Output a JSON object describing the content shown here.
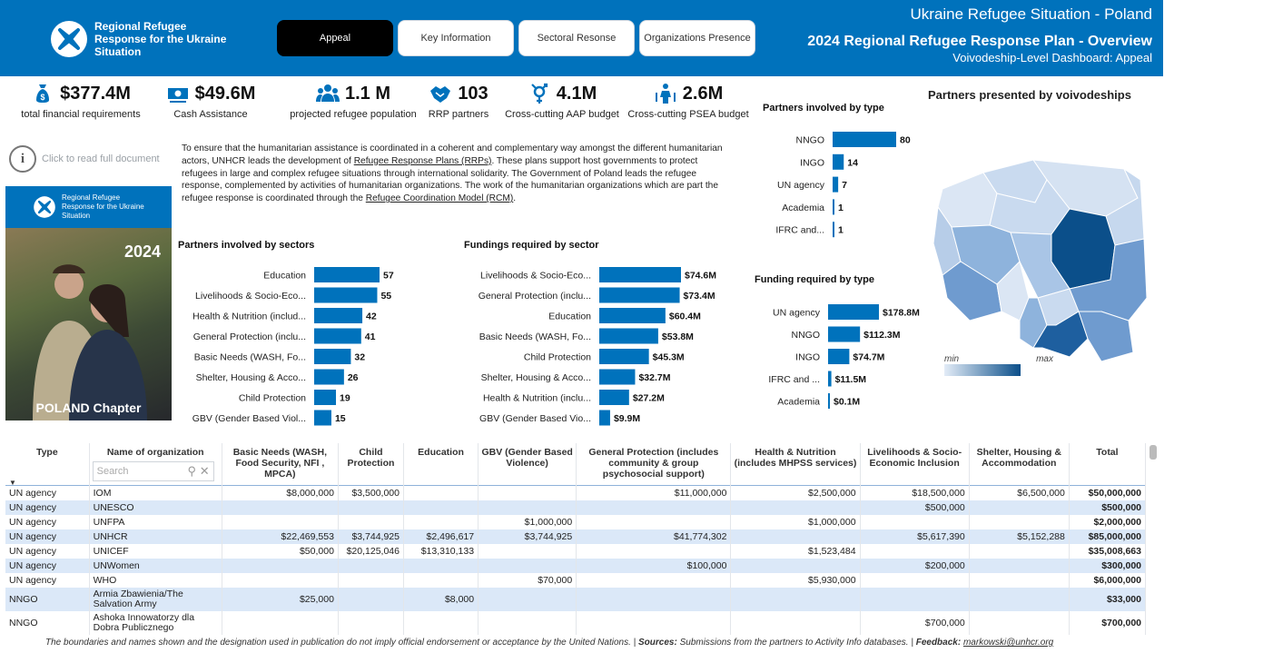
{
  "header": {
    "logo_text": "Regional Refugee Response for the Ukraine Situation",
    "title": "Ukraine Refugee Situation - Poland",
    "subtitle": "2024 Regional Refugee Response Plan - Overview",
    "subtitle2": "Voivodeship-Level Dashboard: Appeal",
    "nav": [
      "Appeal",
      "Key Information",
      "Sectoral Resonse",
      "Organizations Presence"
    ],
    "active_nav": "Appeal"
  },
  "kpis": [
    {
      "value": "$377.4M",
      "label": "total financial requirements",
      "icon": "money-bag-icon"
    },
    {
      "value": "$49.6M",
      "label": "Cash Assistance",
      "icon": "cash-icon"
    },
    {
      "value": "1.1 M",
      "label": "projected refugee population",
      "icon": "people-icon"
    },
    {
      "value": "103",
      "label": "RRP partners",
      "icon": "handshake-icon"
    },
    {
      "value": "4.1M",
      "label": "Cross-cutting AAP budget",
      "icon": "gender-icon"
    },
    {
      "value": "2.6M",
      "label": "Cross-cutting PSEA  budget",
      "icon": "protection-icon"
    }
  ],
  "info": {
    "label": "Click to read full document",
    "icon_glyph": "i"
  },
  "cover": {
    "logo_text": "Regional Refugee Response for the Ukraine Situation",
    "year": "2024",
    "chapter": "POLAND Chapter"
  },
  "intro": {
    "p1": "To ensure that the humanitarian assistance is coordinated in a coherent and complementary way amongst the different humanitarian actors, UNHCR leads the development of ",
    "link1": "Refugee Response Plans (RRPs)",
    "p2": ". These plans support host governments to protect refugees in large and complex refugee situations through international solidarity. The Government of Poland leads the refugee response, complemented by activities of humanitarian organizations. The work of the humanitarian organizations which are part the refugee response is coordinated through the ",
    "link2": "Refugee Coordination Model (RCM)",
    "p3": "."
  },
  "colors": {
    "brand": "#0072bc",
    "bar": "#0072bc",
    "row_alt": "#dbe8f8"
  },
  "chart_data": [
    {
      "type": "bar",
      "orientation": "horizontal",
      "title": "Partners involved by sectors",
      "categories": [
        "Education",
        "Livelihoods & Socio-Eco...",
        "Health & Nutrition (includ...",
        "General Protection (inclu...",
        "Basic Needs (WASH, Fo...",
        "Shelter, Housing & Acco...",
        "Child Protection",
        "GBV (Gender Based Viol..."
      ],
      "values": [
        57,
        55,
        42,
        41,
        32,
        26,
        19,
        15
      ],
      "labels": [
        "57",
        "55",
        "42",
        "41",
        "32",
        "26",
        "19",
        "15"
      ],
      "max": 57
    },
    {
      "type": "bar",
      "orientation": "horizontal",
      "title": "Fundings required by sector",
      "categories": [
        "Livelihoods & Socio-Eco...",
        "General Protection (inclu...",
        "Education",
        "Basic Needs (WASH, Fo...",
        "Child Protection",
        "Shelter, Housing & Acco...",
        "Health & Nutrition (inclu...",
        "GBV (Gender Based Vio..."
      ],
      "values": [
        74.6,
        73.4,
        60.4,
        53.8,
        45.3,
        32.7,
        27.2,
        9.9
      ],
      "labels": [
        "$74.6M",
        "$73.4M",
        "$60.4M",
        "$53.8M",
        "$45.3M",
        "$32.7M",
        "$27.2M",
        "$9.9M"
      ],
      "max": 74.6
    },
    {
      "type": "bar",
      "orientation": "horizontal",
      "title": "Partners involved by type",
      "categories": [
        "NNGO",
        "INGO",
        "UN agency",
        "Academia",
        "IFRC and..."
      ],
      "values": [
        80,
        14,
        7,
        1,
        1
      ],
      "labels": [
        "80",
        "14",
        "7",
        "1",
        "1"
      ],
      "max": 80
    },
    {
      "type": "bar",
      "orientation": "horizontal",
      "title": "Funding required by type",
      "categories": [
        "UN agency",
        "NNGO",
        "INGO",
        "IFRC and ...",
        "Academia"
      ],
      "values": [
        178.8,
        112.3,
        74.7,
        11.5,
        0.1
      ],
      "labels": [
        "$178.8M",
        "$112.3M",
        "$74.7M",
        "$11.5M",
        "$0.1M"
      ],
      "max": 178.8
    }
  ],
  "map": {
    "title": "Partners presented by voivodeships",
    "legend_min": "min",
    "legend_max": "max",
    "color_low": "#e3ecf7",
    "color_high": "#0b4f8a"
  },
  "table": {
    "search_placeholder": "Search",
    "headers": [
      "Type",
      "Name of organization",
      "Basic Needs (WASH, Food Security, NFI , MPCA)",
      "Child Protection",
      "Education",
      "GBV (Gender Based Violence)",
      "General Protection (includes community & group psychosocial support)",
      "Health & Nutrition (includes MHPSS services)",
      "Livelihoods & Socio-Economic Inclusion",
      "Shelter, Housing & Accommodation",
      "Total"
    ],
    "rows": [
      [
        "UN agency",
        "IOM",
        "$8,000,000",
        "$3,500,000",
        "",
        "",
        "$11,000,000",
        "$2,500,000",
        "$18,500,000",
        "$6,500,000",
        "$50,000,000"
      ],
      [
        "UN agency",
        "UNESCO",
        "",
        "",
        "",
        "",
        "",
        "",
        "$500,000",
        "",
        "$500,000"
      ],
      [
        "UN agency",
        "UNFPA",
        "",
        "",
        "",
        "$1,000,000",
        "",
        "$1,000,000",
        "",
        "",
        "$2,000,000"
      ],
      [
        "UN agency",
        "UNHCR",
        "$22,469,553",
        "$3,744,925",
        "$2,496,617",
        "$3,744,925",
        "$41,774,302",
        "",
        "$5,617,390",
        "$5,152,288",
        "$85,000,000"
      ],
      [
        "UN agency",
        "UNICEF",
        "$50,000",
        "$20,125,046",
        "$13,310,133",
        "",
        "",
        "$1,523,484",
        "",
        "",
        "$35,008,663"
      ],
      [
        "UN agency",
        "UNWomen",
        "",
        "",
        "",
        "",
        "$100,000",
        "",
        "$200,000",
        "",
        "$300,000"
      ],
      [
        "UN agency",
        "WHO",
        "",
        "",
        "",
        "$70,000",
        "",
        "$5,930,000",
        "",
        "",
        "$6,000,000"
      ],
      [
        "NNGO",
        "Armia Zbawienia/The Salvation Army",
        "$25,000",
        "",
        "$8,000",
        "",
        "",
        "",
        "",
        "",
        "$33,000"
      ],
      [
        "NNGO",
        "Ashoka Innowatorzy dla Dobra Publicznego",
        "",
        "",
        "",
        "",
        "",
        "",
        "$700,000",
        "",
        "$700,000"
      ]
    ]
  },
  "footer": {
    "text": "The boundaries and names shown and the designation used in publication do not imply official endorsement or acceptance by the United Nations. | ",
    "sources_label": "Sources:",
    "sources_text": " Submissions from the partners to Activity Info databases. | ",
    "feedback_label": "Feedback:",
    "email": "markowski@unhcr.org"
  }
}
